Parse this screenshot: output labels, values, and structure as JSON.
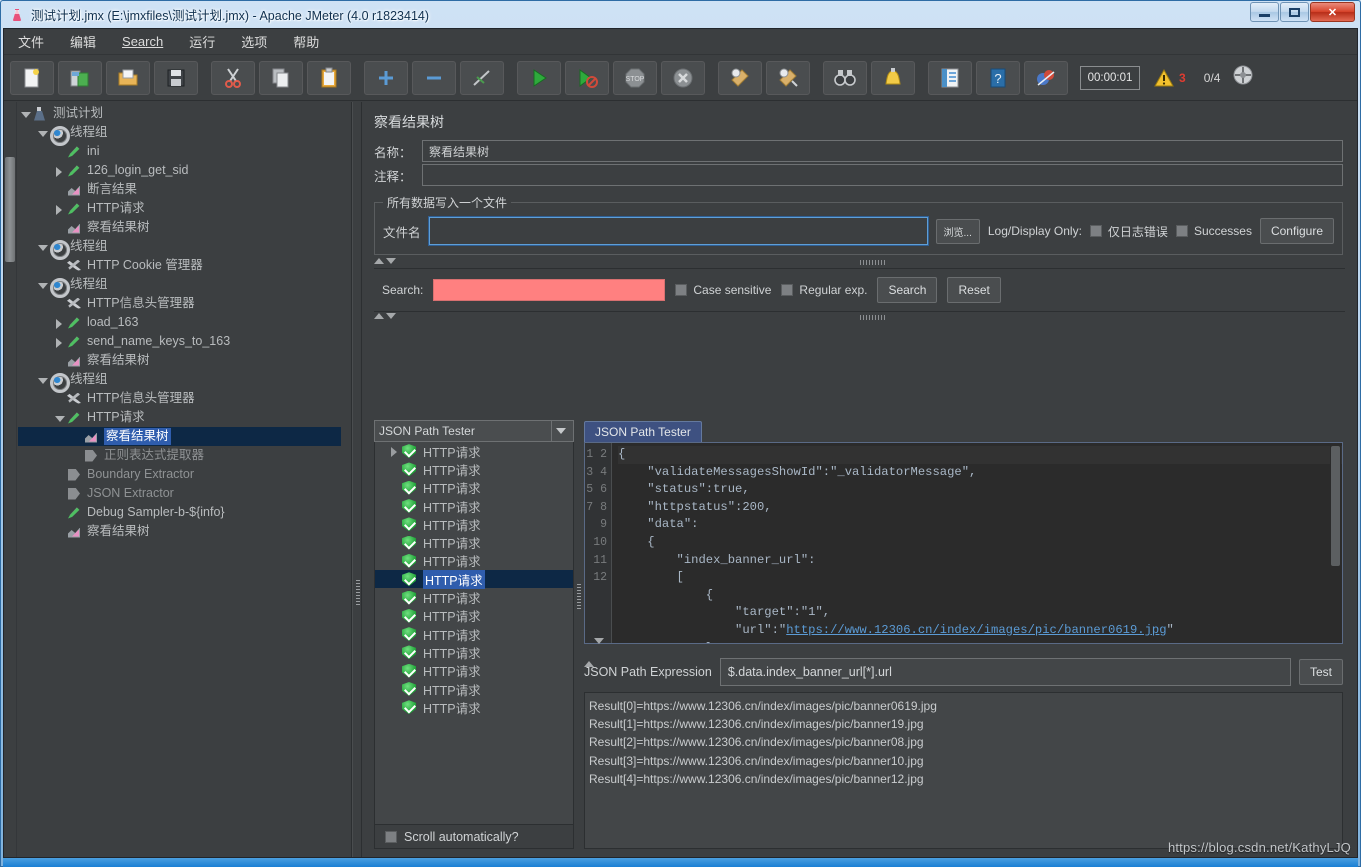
{
  "window": {
    "title": "测试计划.jmx (E:\\jmxfiles\\测试计划.jmx) - Apache JMeter (4.0 r1823414)",
    "icon": "jmeter-flask-icon",
    "minimize_label": "",
    "maximize_label": "",
    "close_label": "✕"
  },
  "menubar": {
    "items": [
      {
        "label": "文件",
        "name": "menu-file"
      },
      {
        "label": "编辑",
        "name": "menu-edit"
      },
      {
        "label": "Search",
        "name": "menu-search"
      },
      {
        "label": "运行",
        "name": "menu-run"
      },
      {
        "label": "选项",
        "name": "menu-options"
      },
      {
        "label": "帮助",
        "name": "menu-help"
      }
    ]
  },
  "toolbar": {
    "buttons": [
      {
        "name": "new-button",
        "icon": "new-document-icon"
      },
      {
        "name": "templates-button",
        "icon": "templates-icon"
      },
      {
        "name": "open-button",
        "icon": "open-folder-icon"
      },
      {
        "name": "save-button",
        "icon": "save-floppy-icon"
      },
      {
        "name": "cut-button",
        "icon": "scissors-icon"
      },
      {
        "name": "copy-button",
        "icon": "copy-icon"
      },
      {
        "name": "paste-button",
        "icon": "clipboard-paste-icon"
      },
      {
        "name": "expand-all-button",
        "icon": "plus-icon"
      },
      {
        "name": "collapse-all-button",
        "icon": "minus-icon"
      },
      {
        "name": "toggle-button",
        "icon": "toggle-icon"
      },
      {
        "name": "start-button",
        "icon": "play-green-icon"
      },
      {
        "name": "start-no-pause-button",
        "icon": "play-no-pause-icon"
      },
      {
        "name": "stop-button",
        "icon": "stop-icon"
      },
      {
        "name": "shutdown-button",
        "icon": "shutdown-icon"
      },
      {
        "name": "clear-button",
        "icon": "broom-clear-icon"
      },
      {
        "name": "clear-all-button",
        "icon": "broom-clear-all-icon"
      },
      {
        "name": "search-button",
        "icon": "binoculars-icon"
      },
      {
        "name": "reset-search-button",
        "icon": "bell-reset-icon"
      },
      {
        "name": "function-helper-button",
        "icon": "function-list-icon"
      },
      {
        "name": "help-button",
        "icon": "help-book-icon"
      },
      {
        "name": "ssl-manager-button",
        "icon": "ssl-manager-icon"
      }
    ],
    "timer": "00:00:01",
    "warning_icon": "warning-triangle-icon",
    "warning_count": "3",
    "thread_ratio": "0/4",
    "remote_icon": "remote-engines-icon"
  },
  "tree": {
    "nodes": [
      {
        "label": "测试计划",
        "icon": "flask-icon",
        "indent": 0,
        "twist": "down",
        "name": "tree-node-test-plan"
      },
      {
        "label": "线程组",
        "icon": "gear-icon",
        "indent": 1,
        "twist": "down",
        "name": "tree-node-thread-group-1"
      },
      {
        "label": "ini",
        "icon": "pen-icon",
        "indent": 2,
        "twist": "none",
        "name": "tree-node-ini"
      },
      {
        "label": "126_login_get_sid",
        "icon": "pen-icon",
        "indent": 2,
        "twist": "right",
        "name": "tree-node-126-login-get-sid"
      },
      {
        "label": "断言结果",
        "icon": "chart-icon",
        "indent": 2,
        "twist": "none",
        "name": "tree-node-assertion-results"
      },
      {
        "label": "HTTP请求",
        "icon": "pen-icon",
        "indent": 2,
        "twist": "right",
        "name": "tree-node-http-request-1"
      },
      {
        "label": "察看结果树",
        "icon": "chart-icon",
        "indent": 2,
        "twist": "none",
        "name": "tree-node-view-results-tree-1"
      },
      {
        "label": "线程组",
        "icon": "gear-icon",
        "indent": 1,
        "twist": "down",
        "name": "tree-node-thread-group-2"
      },
      {
        "label": "HTTP Cookie 管理器",
        "icon": "wrench-icon",
        "indent": 2,
        "twist": "none",
        "name": "tree-node-http-cookie-manager"
      },
      {
        "label": "线程组",
        "icon": "gear-icon",
        "indent": 1,
        "twist": "down",
        "name": "tree-node-thread-group-3"
      },
      {
        "label": "HTTP信息头管理器",
        "icon": "wrench-icon",
        "indent": 2,
        "twist": "none",
        "name": "tree-node-http-header-manager-1"
      },
      {
        "label": "load_163",
        "icon": "pen-icon",
        "indent": 2,
        "twist": "right",
        "name": "tree-node-load-163"
      },
      {
        "label": "send_name_keys_to_163",
        "icon": "pen-icon",
        "indent": 2,
        "twist": "right",
        "name": "tree-node-send-name-keys-to-163"
      },
      {
        "label": "察看结果树",
        "icon": "chart-icon",
        "indent": 2,
        "twist": "none",
        "name": "tree-node-view-results-tree-2"
      },
      {
        "label": "线程组",
        "icon": "gear-icon",
        "indent": 1,
        "twist": "down",
        "name": "tree-node-thread-group-4"
      },
      {
        "label": "HTTP信息头管理器",
        "icon": "wrench-icon",
        "indent": 2,
        "twist": "none",
        "name": "tree-node-http-header-manager-2"
      },
      {
        "label": "HTTP请求",
        "icon": "pen-icon",
        "indent": 2,
        "twist": "down",
        "name": "tree-node-http-request-2"
      },
      {
        "label": "察看结果树",
        "icon": "chart-icon",
        "indent": 3,
        "twist": "none",
        "selected": true,
        "name": "tree-node-view-results-tree-selected"
      },
      {
        "label": "正则表达式提取器",
        "icon": "extractor-icon",
        "indent": 3,
        "twist": "none",
        "dim": true,
        "name": "tree-node-regex-extractor"
      },
      {
        "label": "Boundary Extractor",
        "icon": "extractor-icon",
        "indent": 2,
        "twist": "none",
        "dim": true,
        "name": "tree-node-boundary-extractor"
      },
      {
        "label": "JSON Extractor",
        "icon": "extractor-icon",
        "indent": 2,
        "twist": "none",
        "dim": true,
        "name": "tree-node-json-extractor"
      },
      {
        "label": "Debug Sampler-b-${info}",
        "icon": "pen-icon",
        "indent": 2,
        "twist": "none",
        "name": "tree-node-debug-sampler"
      },
      {
        "label": "察看结果树",
        "icon": "chart-icon",
        "indent": 2,
        "twist": "none",
        "name": "tree-node-view-results-tree-3"
      }
    ]
  },
  "panel": {
    "title": "察看结果树",
    "name_label": "名称：",
    "name_value": "察看结果树",
    "comment_label": "注释：",
    "comment_value": "",
    "group_legend": "所有数据写入一个文件",
    "filename_label": "文件名",
    "filename_value": "",
    "browse_label": "浏览...",
    "log_display_only_label": "Log/Display Only:",
    "errors_only_label": "仅日志错误",
    "successes_label": "Successes",
    "configure_label": "Configure"
  },
  "search": {
    "label": "Search:",
    "value": "",
    "case_sensitive_label": "Case sensitive",
    "regular_exp_label": "Regular exp.",
    "search_button": "Search",
    "reset_button": "Reset"
  },
  "renderer": {
    "selected": "JSON Path Tester",
    "tab_label": "JSON Path Tester"
  },
  "results": {
    "items": [
      {
        "label": "HTTP请求",
        "twist": "right",
        "status": "success"
      },
      {
        "label": "HTTP请求",
        "twist": "none",
        "status": "success"
      },
      {
        "label": "HTTP请求",
        "twist": "none",
        "status": "success"
      },
      {
        "label": "HTTP请求",
        "twist": "none",
        "status": "success"
      },
      {
        "label": "HTTP请求",
        "twist": "none",
        "status": "success"
      },
      {
        "label": "HTTP请求",
        "twist": "none",
        "status": "success"
      },
      {
        "label": "HTTP请求",
        "twist": "none",
        "status": "success"
      },
      {
        "label": "HTTP请求",
        "twist": "none",
        "status": "success",
        "selected": true
      },
      {
        "label": "HTTP请求",
        "twist": "none",
        "status": "success"
      },
      {
        "label": "HTTP请求",
        "twist": "none",
        "status": "success"
      },
      {
        "label": "HTTP请求",
        "twist": "none",
        "status": "success"
      },
      {
        "label": "HTTP请求",
        "twist": "none",
        "status": "success"
      },
      {
        "label": "HTTP请求",
        "twist": "none",
        "status": "success"
      },
      {
        "label": "HTTP请求",
        "twist": "none",
        "status": "success"
      },
      {
        "label": "HTTP请求",
        "twist": "none",
        "status": "success"
      }
    ],
    "scroll_automatically_label": "Scroll automatically?"
  },
  "code": {
    "line_numbers": [
      "1",
      "2",
      "3",
      "4",
      "5",
      "6",
      "7",
      "8",
      "9",
      "10",
      "11",
      "12"
    ],
    "lines": [
      "{",
      "    \"validateMessagesShowId\":\"_validatorMessage\",",
      "    \"status\":true,",
      "    \"httpstatus\":200,",
      "    \"data\":",
      "    {",
      "        \"index_banner_url\":",
      "        [",
      "            {",
      "                \"target\":\"1\",",
      "                \"url\":\"https://www.12306.cn/index/images/pic/banner0619.jpg\"",
      "            },"
    ],
    "link_text": "https://www.12306.cn/index/images/pic/banner0619.jpg"
  },
  "jsonpath": {
    "expression_label": "JSON Path Expression",
    "expression_value": "$.data.index_banner_url[*].url",
    "test_button": "Test",
    "results": [
      "Result[0]=https://www.12306.cn/index/images/pic/banner0619.jpg",
      "Result[1]=https://www.12306.cn/index/images/pic/banner19.jpg",
      "Result[2]=https://www.12306.cn/index/images/pic/banner08.jpg",
      "Result[3]=https://www.12306.cn/index/images/pic/banner10.jpg",
      "Result[4]=https://www.12306.cn/index/images/pic/banner12.jpg"
    ]
  },
  "watermark": "https://blog.csdn.net/KathyLJQ",
  "colors": {
    "window_bg": "#3c3f41",
    "accent_selection": "#2f5dad",
    "selection_row": "#0d2845",
    "search_highlight": "#ff8080",
    "code_bg": "#2b2b2b",
    "link": "#5b9bd5",
    "warning": "#e03c31",
    "success_green": "#189c31",
    "status_bar": "#1a7fd4"
  }
}
